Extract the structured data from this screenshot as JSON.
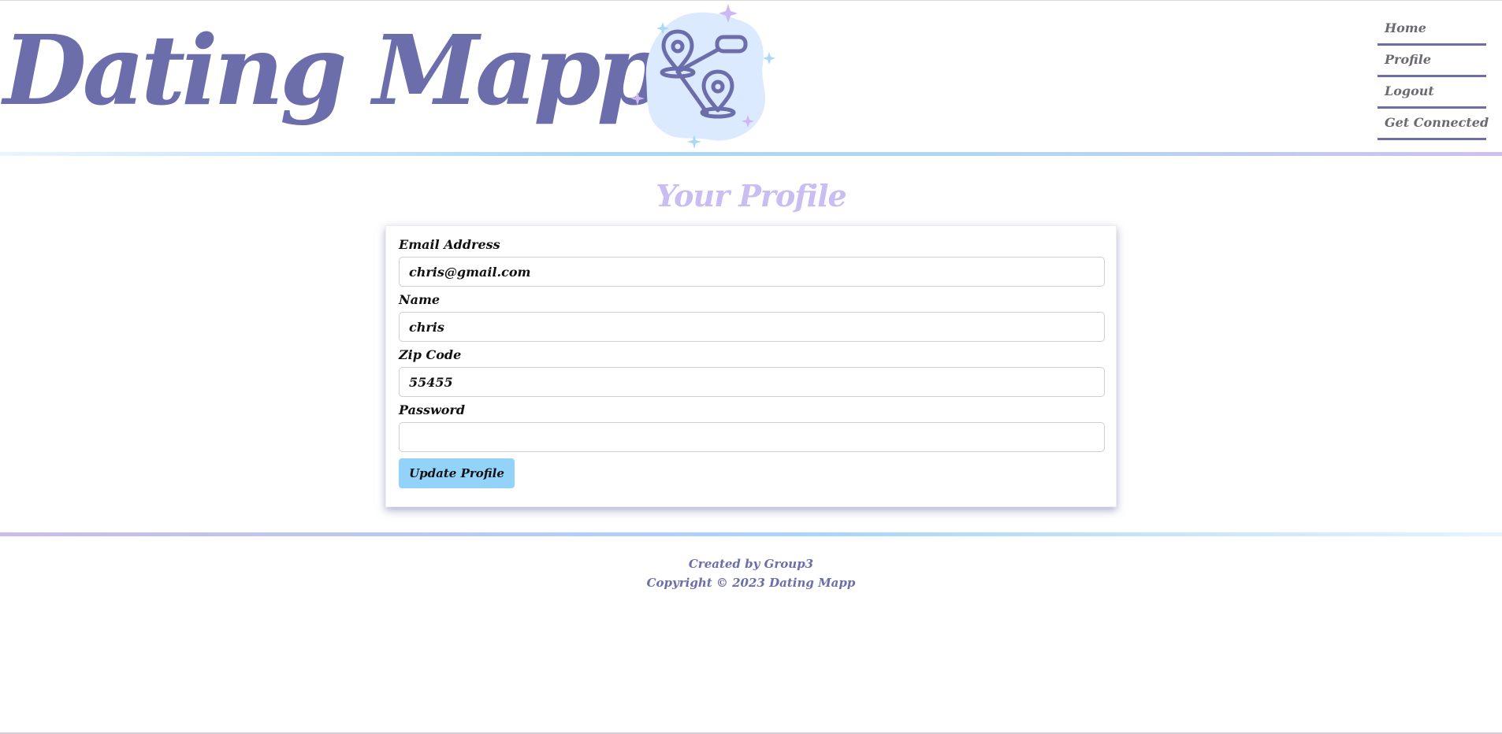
{
  "colors": {
    "brand": "#6c6dab",
    "title_lavender": "#c9bdf2",
    "button_blue": "#93d3fa",
    "nav_text": "#6a6a70"
  },
  "header": {
    "logo_text": "Dating Mapp",
    "logo_icon": "map-pins-route-icon"
  },
  "nav": {
    "items": [
      {
        "label": "Home"
      },
      {
        "label": "Profile"
      },
      {
        "label": "Logout"
      },
      {
        "label": "Get Connected"
      }
    ]
  },
  "main": {
    "title": "Your Profile",
    "form": {
      "email": {
        "label": "Email Address",
        "value": "chris@gmail.com"
      },
      "name": {
        "label": "Name",
        "value": "chris"
      },
      "zip": {
        "label": "Zip Code",
        "value": "55455"
      },
      "password": {
        "label": "Password",
        "value": ""
      },
      "submit_label": "Update Profile"
    }
  },
  "footer": {
    "credit": "Created by Group3",
    "copyright": "Copyright © 2023 Dating Mapp"
  }
}
